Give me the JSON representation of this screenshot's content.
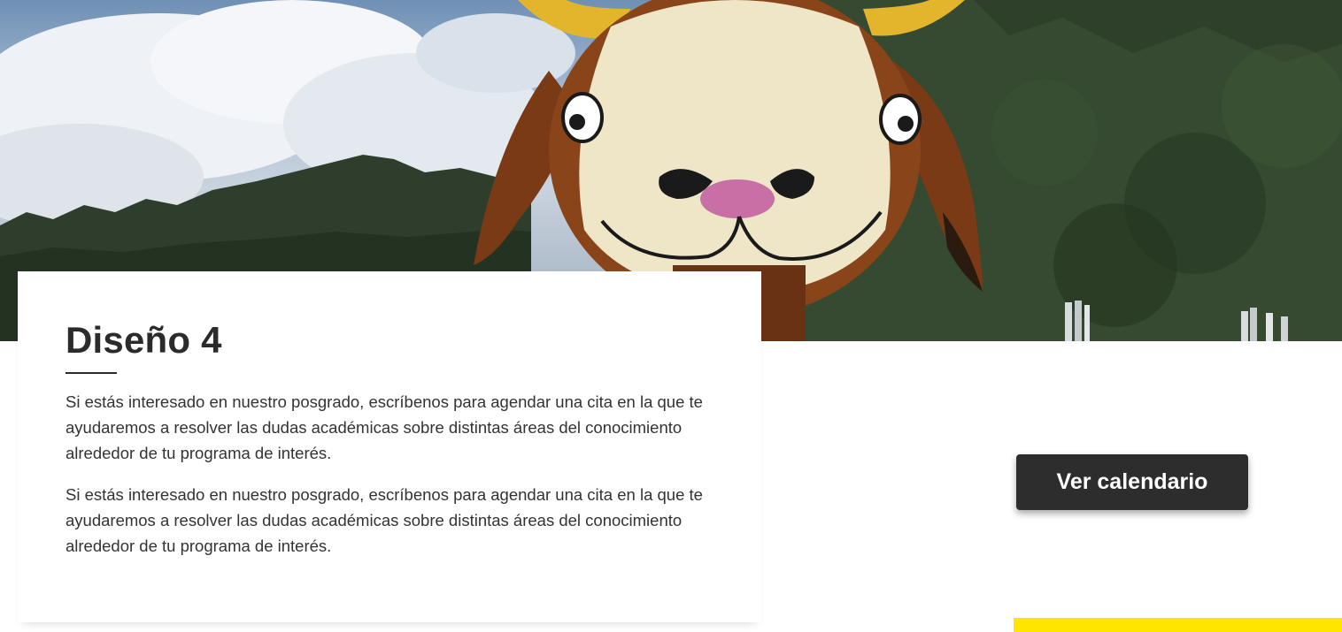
{
  "hero": {
    "image": "mascot-goat-costume-photo"
  },
  "card": {
    "title": "Diseño 4",
    "paragraphs": [
      "Si estás interesado en nuestro posgrado, escríbenos para agendar una cita en la que te ayudaremos a resolver las dudas académicas sobre distintas áreas del conocimiento alrededor de tu programa de interés.",
      "Si estás interesado en nuestro posgrado, escríbenos para agendar una cita en la que te ayudaremos a resolver las dudas académicas sobre distintas áreas del conocimiento alrededor de tu programa de interés."
    ]
  },
  "cta": {
    "label": "Ver calendario"
  },
  "colors": {
    "accent": "#ffe600",
    "button": "#2d2d2d",
    "text": "#2b2b2b"
  }
}
